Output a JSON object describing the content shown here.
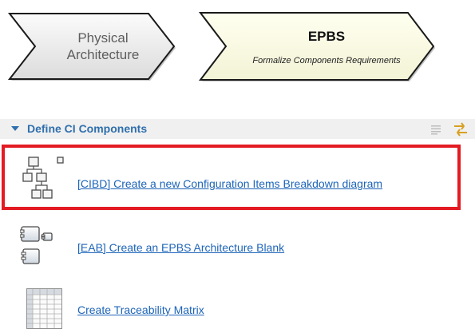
{
  "phases": {
    "physical": {
      "line1": "Physical",
      "line2": "Architecture"
    },
    "epbs": {
      "title": "EPBS",
      "subtitle": "Formalize Components Requirements"
    }
  },
  "section": {
    "title": "Define CI Components",
    "collapse_icon": "collapse-list-icon",
    "sync_icon": "sync-arrows-icon"
  },
  "items": [
    {
      "label": "[CIBD] Create a new Configuration Items Breakdown diagram",
      "icon": "breakdown-tree-icon"
    },
    {
      "label": "[EAB] Create an EPBS Architecture Blank",
      "icon": "architecture-blank-icon"
    },
    {
      "label": "Create Traceability Matrix",
      "icon": "matrix-table-icon"
    }
  ],
  "colors": {
    "link": "#1d64b8",
    "section_title": "#2f6fad",
    "highlight_border": "#e31b23"
  }
}
